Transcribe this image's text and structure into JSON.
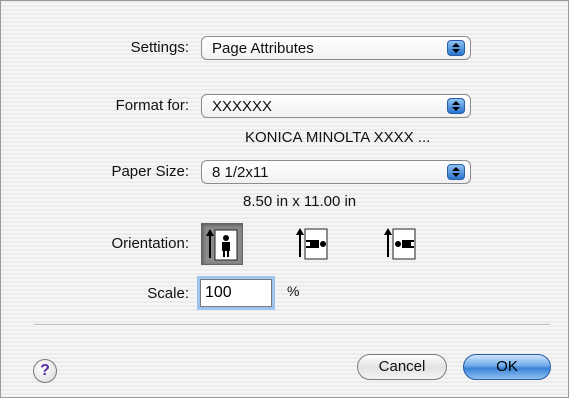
{
  "settings": {
    "label": "Settings:",
    "value": "Page Attributes"
  },
  "format": {
    "label": "Format for:",
    "value": "XXXXXX",
    "printer": "KONICA MINOLTA  XXXX ..."
  },
  "paper": {
    "label": "Paper Size:",
    "value": "8 1/2x11",
    "dimensions": "8.50 in x 11.00 in"
  },
  "orientation": {
    "label": "Orientation:",
    "options": [
      {
        "name": "portrait",
        "selected": true
      },
      {
        "name": "landscape-left",
        "selected": false
      },
      {
        "name": "landscape-right",
        "selected": false
      }
    ]
  },
  "scale": {
    "label": "Scale:",
    "value": "100",
    "unit": "%"
  },
  "buttons": {
    "help": "?",
    "cancel": "Cancel",
    "ok": "OK"
  },
  "colors": {
    "accent": "#3b82d6",
    "selected_orientation": "#8b8b8b",
    "help_glyph": "#5b2c9c"
  }
}
